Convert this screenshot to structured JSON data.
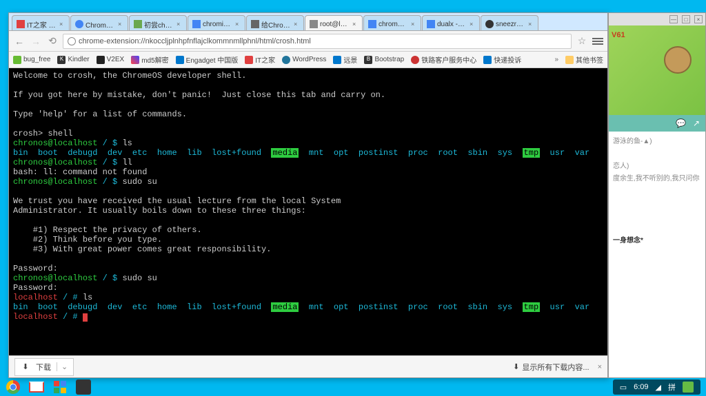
{
  "tabs": [
    {
      "title": "IT之家 - 百",
      "icon": "#e04040"
    },
    {
      "title": "Chrome 网",
      "icon": "#4285f4"
    },
    {
      "title": "初尝chrom",
      "icon": "#6aa84f"
    },
    {
      "title": "chromium",
      "icon": "#4285f4"
    },
    {
      "title": "给Chrom!",
      "icon": "#666"
    },
    {
      "title": "root@loca",
      "icon": "#888",
      "active": true
    },
    {
      "title": "chromeos",
      "icon": "#4285f4"
    },
    {
      "title": "dualx - Go",
      "icon": "#4285f4"
    },
    {
      "title": "sneezry/D",
      "icon": "#333"
    }
  ],
  "omnibox_url": "chrome-extension://nkoccljplnhpfnflajclkommnmllphnl/html/crosh.html",
  "bookmarks": [
    {
      "label": "bug_free"
    },
    {
      "label": "Kindler"
    },
    {
      "label": "V2EX"
    },
    {
      "label": "md5解密"
    },
    {
      "label": "Engadget 中国版"
    },
    {
      "label": "IT之家"
    },
    {
      "label": "WordPress"
    },
    {
      "label": "远景"
    },
    {
      "label": "Bootstrap"
    },
    {
      "label": "铁路客户服务中心"
    },
    {
      "label": "快递投诉"
    }
  ],
  "other_bookmarks": "其他书签",
  "terminal": {
    "welcome": "Welcome to crosh, the ChromeOS developer shell.",
    "mistake": "If you got here by mistake, don't panic!  Just close this tab and carry on.",
    "help": "Type 'help' for a list of commands.",
    "prompt_crosh": "crosh> ",
    "cmd_shell": "shell",
    "user_host": "chronos@localhost",
    "path_sep": " / $ ",
    "cmd_ls": "ls",
    "cmd_ll": "ll",
    "cmd_sudo": "sudo su",
    "ls_out": {
      "b1": "bin  boot  debugd  dev  etc  home  lib  lost+found  ",
      "media": "media",
      "b2": "  mnt  opt  postinst  proc  root  sbin  sys  ",
      "tmp": "tmp",
      "b3": "  usr  var"
    },
    "bash_err": "bash: ll: command not found",
    "lecture1": "We trust you have received the usual lecture from the local System",
    "lecture2": "Administrator. It usually boils down to these three things:",
    "rule1": "    #1) Respect the privacy of others.",
    "rule2": "    #2) Think before you type.",
    "rule3": "    #3) With great power comes great responsibility.",
    "password": "Password: ",
    "root_host": "localhost",
    "root_sep": " / # "
  },
  "download": {
    "item": "下载",
    "showall": "显示所有下载内容..."
  },
  "right_panel": {
    "label": "V61",
    "lines": [
      "游泳的鱼-▲)",
      "恋人)",
      "度余生,我不听别的,我只问你",
      "一身想念*"
    ]
  },
  "tray": {
    "time": "6:09"
  }
}
